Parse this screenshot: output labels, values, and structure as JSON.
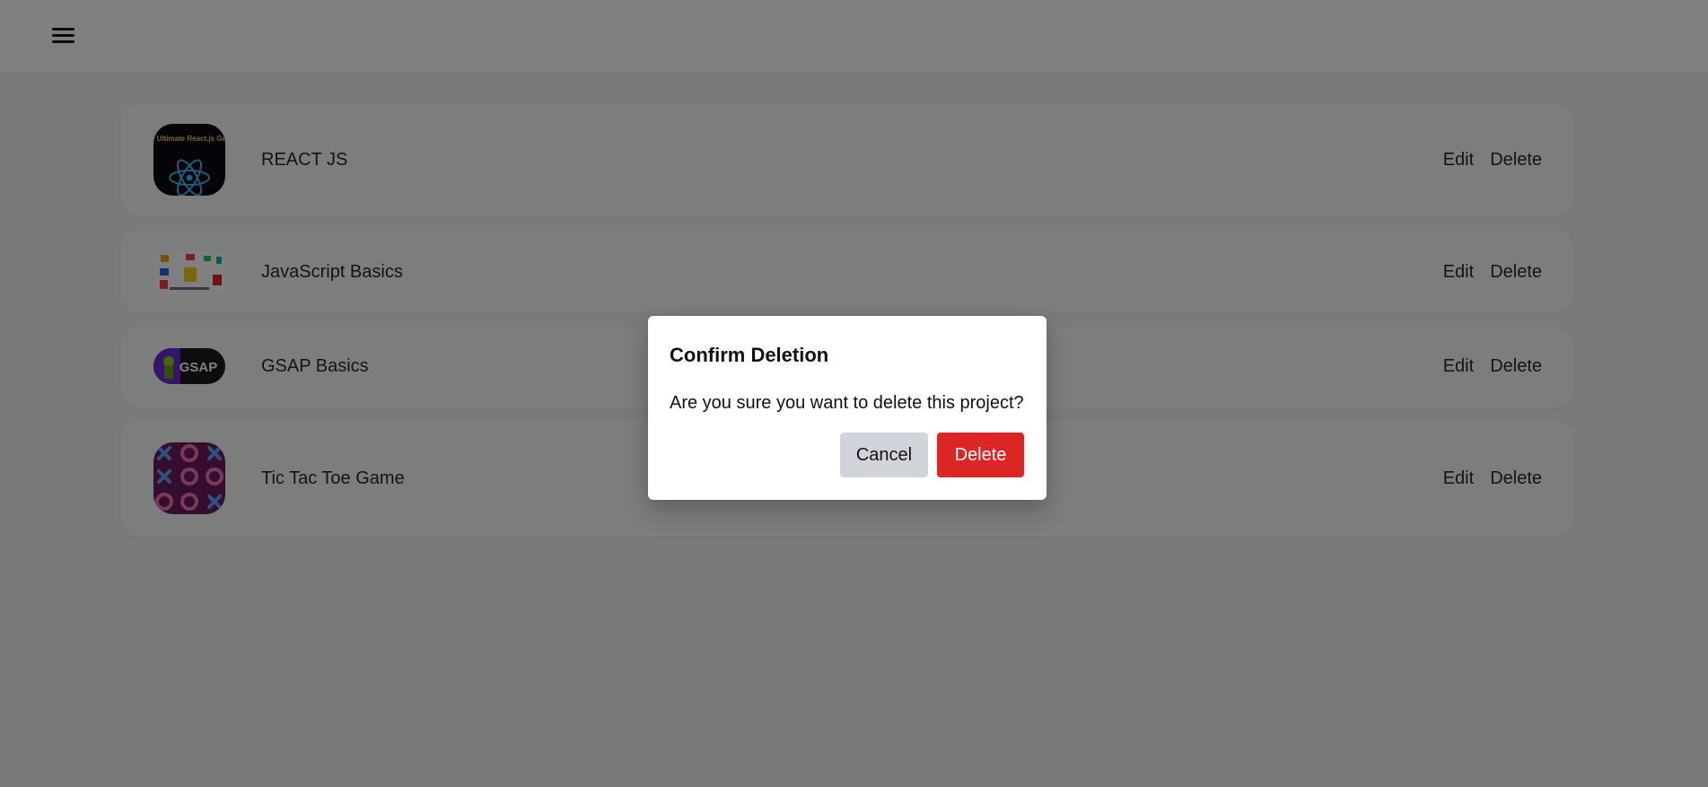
{
  "header": {
    "menu_icon": "hamburger-menu-icon"
  },
  "projects": [
    {
      "title": "REACT JS",
      "thumbnail_text": "The Ultimate React.js Guide",
      "edit_label": "Edit",
      "delete_label": "Delete"
    },
    {
      "title": "JavaScript Basics",
      "edit_label": "Edit",
      "delete_label": "Delete"
    },
    {
      "title": "GSAP Basics",
      "thumbnail_text": "GSAP",
      "edit_label": "Edit",
      "delete_label": "Delete"
    },
    {
      "title": "Tic Tac Toe Game",
      "edit_label": "Edit",
      "delete_label": "Delete"
    }
  ],
  "dialog": {
    "title": "Confirm Deletion",
    "message": "Are you sure you want to delete this project?",
    "cancel_label": "Cancel",
    "delete_label": "Delete"
  },
  "colors": {
    "danger": "#dc2626",
    "secondary": "#d1d5db",
    "overlay": "rgba(0,0,0,0.5)"
  }
}
